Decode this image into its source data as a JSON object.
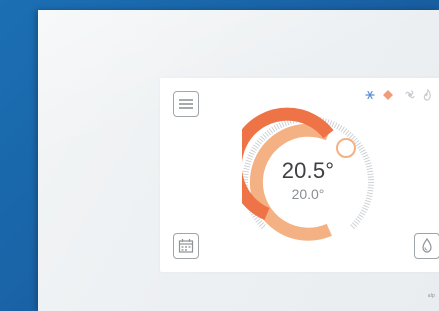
{
  "thermostat": {
    "current_temp": "20.5°",
    "set_temp": "20.0°"
  },
  "icons": {
    "menu": "menu-icon",
    "calendar": "calendar-icon",
    "humidity": "drop-icon",
    "modes": [
      "snowflake-icon",
      "heat-icon",
      "fan-icon",
      "flame-icon"
    ]
  },
  "colors": {
    "arc_primary": "#ee7447",
    "arc_secondary": "#f4b183",
    "snowflake": "#5a8fd3",
    "heat": "#f19b7a",
    "inactive": "#c9cdd1",
    "background": "#1a62a6"
  },
  "brand_text": "alp"
}
